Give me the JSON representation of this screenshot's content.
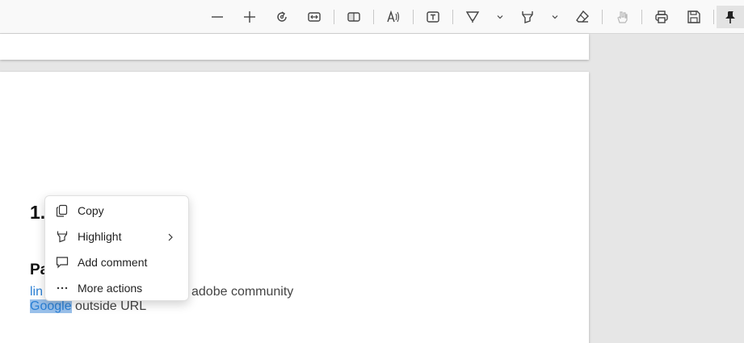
{
  "toolbar": {
    "buttons": [
      {
        "name": "zoom-out-icon"
      },
      {
        "name": "zoom-in-icon"
      },
      {
        "name": "rotate-icon"
      },
      {
        "name": "fit-width-icon"
      },
      {
        "name": "page-view-icon"
      },
      {
        "name": "read-aloud-icon"
      },
      {
        "name": "text-box-icon"
      },
      {
        "name": "draw-icon"
      },
      {
        "name": "highlight-icon"
      },
      {
        "name": "eraser-icon"
      },
      {
        "name": "touch-icon"
      },
      {
        "name": "print-icon"
      },
      {
        "name": "save-icon"
      },
      {
        "name": "pin-icon"
      }
    ]
  },
  "document": {
    "heading": "1.",
    "para_heading": "Pa",
    "line1_link": "lin",
    "line1_rest": "adobe community",
    "line2_selected": "Google",
    "line2_rest": " outside URL"
  },
  "context_menu": {
    "items": [
      {
        "label": "Copy",
        "icon": "copy-icon"
      },
      {
        "label": "Highlight",
        "icon": "highlight-icon",
        "has_submenu": true
      },
      {
        "label": "Add comment",
        "icon": "comment-icon"
      },
      {
        "label": "More actions",
        "icon": "more-icon"
      }
    ]
  },
  "colors": {
    "link": "#2a7fd4",
    "selection": "#99c0ea",
    "toolbar_bg": "#f9f9f9",
    "viewer_bg": "#e6e6e6"
  }
}
